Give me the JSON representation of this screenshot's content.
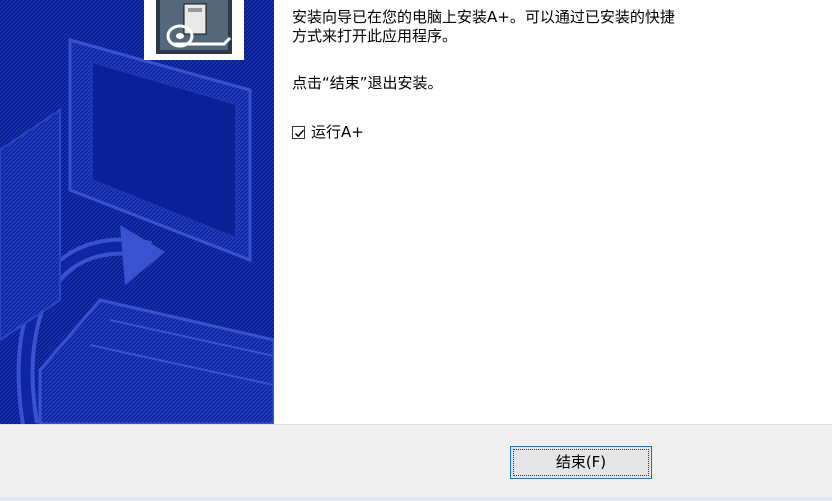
{
  "message": {
    "line1": "安装向导已在您的电脑上安装A+。可以通过已安装的快捷",
    "line2": "方式来打开此应用程序。",
    "line3": "点击“结束”退出安装。"
  },
  "run_option": {
    "label": "运行A+",
    "checked": true
  },
  "buttons": {
    "finish_label": "结束(F)"
  },
  "colors": {
    "banner": "#0a1f8f",
    "button_border": "#0078d7",
    "bottom_bar": "#f0f0f0"
  },
  "icons": {
    "banner": "setup-computer-arrow-illustration",
    "logo": "installer-logo-icon",
    "checkbox": "checkbox-checked-icon"
  }
}
